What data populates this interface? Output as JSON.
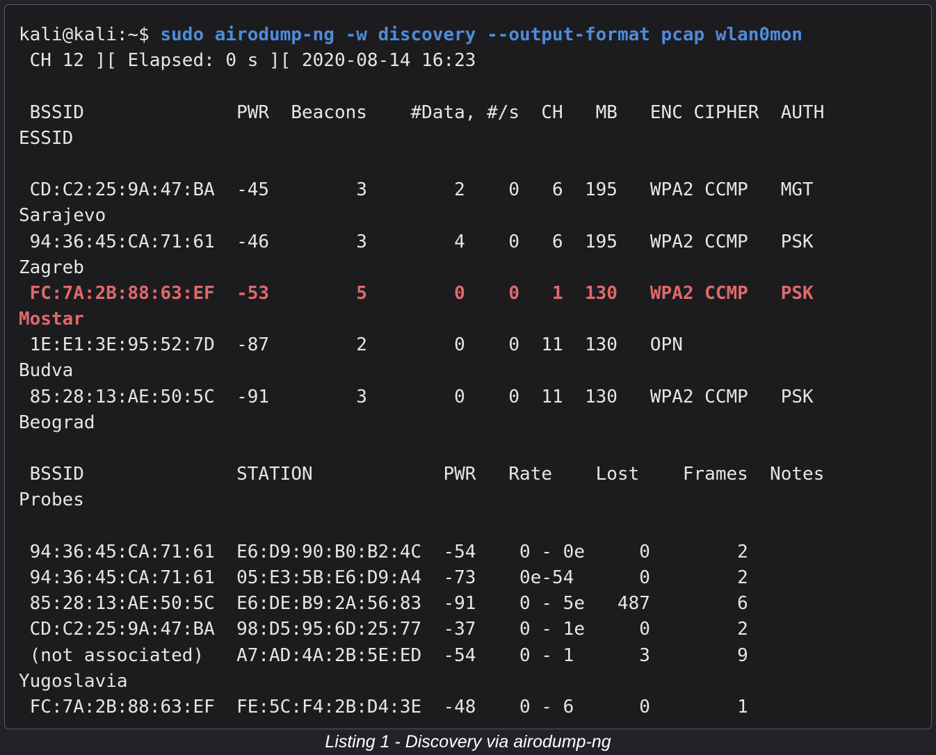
{
  "terminal": {
    "prompt": "kali@kali:~$ ",
    "command": "sudo airodump-ng -w discovery --output-format pcap wlan0mon",
    "status_line": " CH 12 ][ Elapsed: 0 s ][ 2020-08-14 16:23",
    "ap_header": " BSSID              PWR  Beacons    #Data, #/s  CH   MB   ENC CIPHER  AUTH",
    "ap_header_essid": "ESSID",
    "ap_rows": [
      {
        "line": " CD:C2:25:9A:47:BA  -45        3        2    0   6  195   WPA2 CCMP   MGT",
        "essid": "Sarajevo",
        "highlight": false
      },
      {
        "line": " 94:36:45:CA:71:61  -46        3        4    0   6  195   WPA2 CCMP   PSK",
        "essid": "Zagreb",
        "highlight": false
      },
      {
        "line": " FC:7A:2B:88:63:EF  -53        5        0    0   1  130   WPA2 CCMP   PSK",
        "essid": "Mostar",
        "highlight": true
      },
      {
        "line": " 1E:E1:3E:95:52:7D  -87        2        0    0  11  130   OPN",
        "essid": "Budva",
        "highlight": false
      },
      {
        "line": " 85:28:13:AE:50:5C  -91        3        0    0  11  130   WPA2 CCMP   PSK",
        "essid": "Beograd",
        "highlight": false
      }
    ],
    "station_header": " BSSID              STATION            PWR   Rate    Lost    Frames  Notes",
    "station_header_probes": "Probes",
    "station_rows": [
      " 94:36:45:CA:71:61  E6:D9:90:B0:B2:4C  -54    0 - 0e     0        2",
      " 94:36:45:CA:71:61  05:E3:5B:E6:D9:A4  -73    0e-54      0        2",
      " 85:28:13:AE:50:5C  E6:DE:B9:2A:56:83  -91    0 - 5e   487        6",
      " CD:C2:25:9A:47:BA  98:D5:95:6D:25:77  -37    0 - 1e     0        2",
      " (not associated)   A7:AD:4A:2B:5E:ED  -54    0 - 1      3        9",
      "Yugoslavia",
      " FC:7A:2B:88:63:EF  FE:5C:F4:2B:D4:3E  -48    0 - 6      0        1"
    ]
  },
  "caption": "Listing 1 - Discovery via airodump-ng",
  "colors": {
    "background": "#252128",
    "terminal_bg": "#1c1c1f",
    "text": "#e6e6e6",
    "command": "#4f8cd8",
    "highlight": "#e0696b"
  }
}
